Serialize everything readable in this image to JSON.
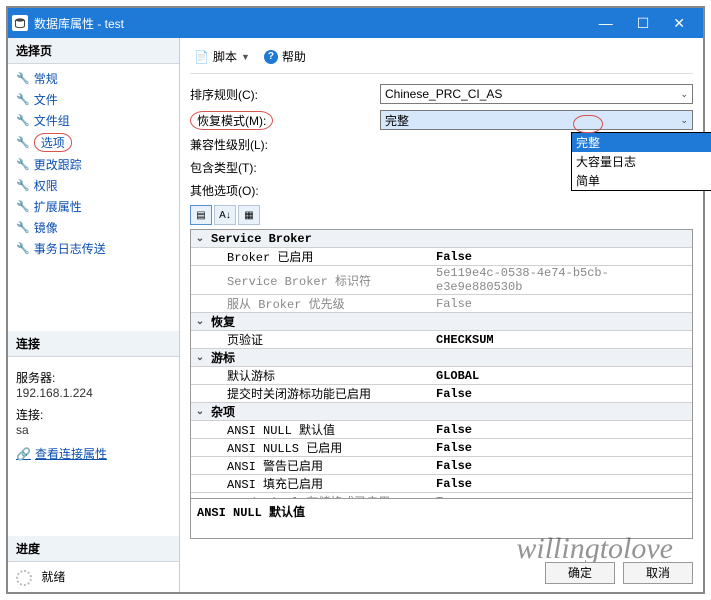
{
  "window": {
    "title": "数据库属性 - test"
  },
  "left": {
    "select_page": "选择页",
    "nav": [
      "常规",
      "文件",
      "文件组",
      "选项",
      "更改跟踪",
      "权限",
      "扩展属性",
      "镜像",
      "事务日志传送"
    ],
    "highlighted_index": 3,
    "connection_head": "连接",
    "server_label": "服务器:",
    "server_value": "192.168.1.224",
    "conn_label": "连接:",
    "conn_value": "sa",
    "view_link": "查看连接属性",
    "progress_head": "进度",
    "ready": "就绪"
  },
  "toolbar": {
    "script": "脚本",
    "help": "帮助"
  },
  "form": {
    "collation_label": "排序规则(C):",
    "collation_value": "Chinese_PRC_CI_AS",
    "recovery_label": "恢复模式(M):",
    "recovery_value": "完整",
    "compat_label": "兼容性级别(L):",
    "containment_label": "包含类型(T):",
    "other_label": "其他选项(O):"
  },
  "dropdown": {
    "options": [
      "完整",
      "大容量日志",
      "简单"
    ],
    "selected_index": 0
  },
  "grid": {
    "cats": [
      {
        "name": "Service Broker",
        "rows": [
          {
            "k": "Broker 已启用",
            "v": "False",
            "bold": true
          },
          {
            "k": "Service Broker 标识符",
            "v": "5e119e4c-0538-4e74-b5cb-e3e9e880530b",
            "dim": true
          },
          {
            "k": "服从 Broker 优先级",
            "v": "False",
            "dim": true
          }
        ]
      },
      {
        "name": "恢复",
        "rows": [
          {
            "k": "页验证",
            "v": "CHECKSUM",
            "bold": true
          }
        ]
      },
      {
        "name": "游标",
        "rows": [
          {
            "k": "默认游标",
            "v": "GLOBAL",
            "bold": true
          },
          {
            "k": "提交时关闭游标功能已启用",
            "v": "False",
            "bold": true
          }
        ]
      },
      {
        "name": "杂项",
        "rows": [
          {
            "k": "ANSI NULL 默认值",
            "v": "False",
            "bold": true
          },
          {
            "k": "ANSI NULLS 已启用",
            "v": "False",
            "bold": true
          },
          {
            "k": "ANSI 警告已启用",
            "v": "False",
            "bold": true
          },
          {
            "k": "ANSI 填充已启用",
            "v": "False",
            "bold": true
          },
          {
            "k": "Vardecimal 存储格式已启用",
            "v": "True",
            "dim": true
          }
        ]
      }
    ],
    "desc": "ANSI NULL 默认值"
  },
  "footer": {
    "ok": "确定",
    "cancel": "取消"
  },
  "watermark": "willingtolove"
}
